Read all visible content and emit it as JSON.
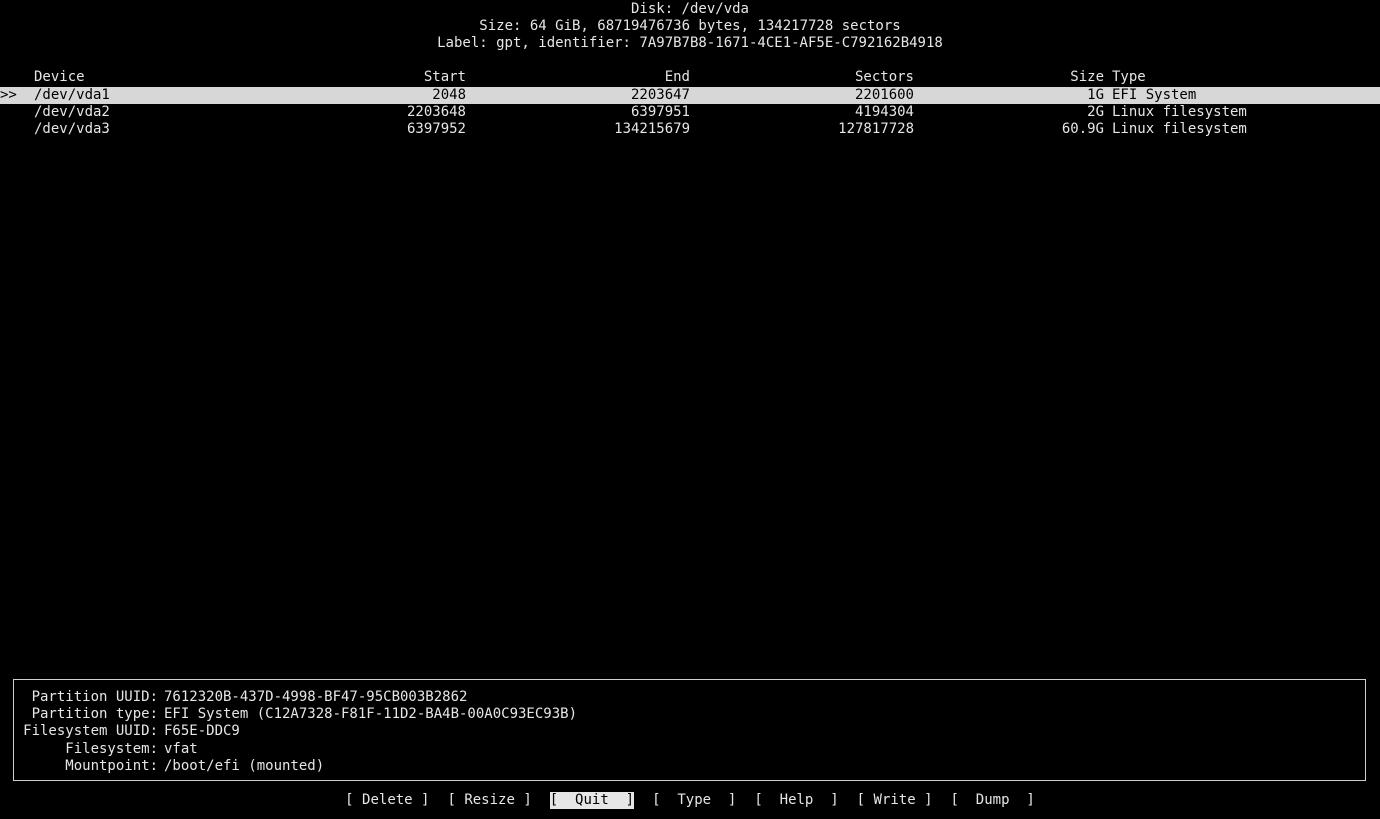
{
  "header": {
    "disk": "Disk: /dev/vda",
    "size": "Size: 64 GiB, 68719476736 bytes, 134217728 sectors",
    "label": "Label: gpt, identifier: 7A97B7B8-1671-4CE1-AF5E-C792162B4918"
  },
  "table": {
    "columns": {
      "device": "Device",
      "start": "Start",
      "end": "End",
      "sectors": "Sectors",
      "size": "Size",
      "type": "Type"
    },
    "selected_marker": ">>",
    "rows": [
      {
        "device": "/dev/vda1",
        "start": "2048",
        "end": "2203647",
        "sectors": "2201600",
        "size": "1G",
        "type": "EFI System"
      },
      {
        "device": "/dev/vda2",
        "start": "2203648",
        "end": "6397951",
        "sectors": "4194304",
        "size": "2G",
        "type": "Linux filesystem"
      },
      {
        "device": "/dev/vda3",
        "start": "6397952",
        "end": "134215679",
        "sectors": "127817728",
        "size": "60.9G",
        "type": "Linux filesystem"
      }
    ]
  },
  "info": {
    "partition_uuid_label": "Partition UUID:",
    "partition_uuid_value": "7612320B-437D-4998-BF47-95CB003B2862",
    "partition_type_label": "Partition type:",
    "partition_type_value": "EFI System (C12A7328-F81F-11D2-BA4B-00A0C93EC93B)",
    "filesystem_uuid_label": "Filesystem UUID:",
    "filesystem_uuid_value": "F65E-DDC9",
    "filesystem_label": "Filesystem:",
    "filesystem_value": "vfat",
    "mountpoint_label": "Mountpoint:",
    "mountpoint_value": "/boot/efi (mounted)"
  },
  "menu": {
    "delete": "[ Delete ]",
    "resize": "[ Resize ]",
    "quit": "[  Quit  ]",
    "type": "[  Type  ]",
    "help": "[  Help  ]",
    "write": "[ Write ]",
    "dump": "[  Dump  ]"
  }
}
